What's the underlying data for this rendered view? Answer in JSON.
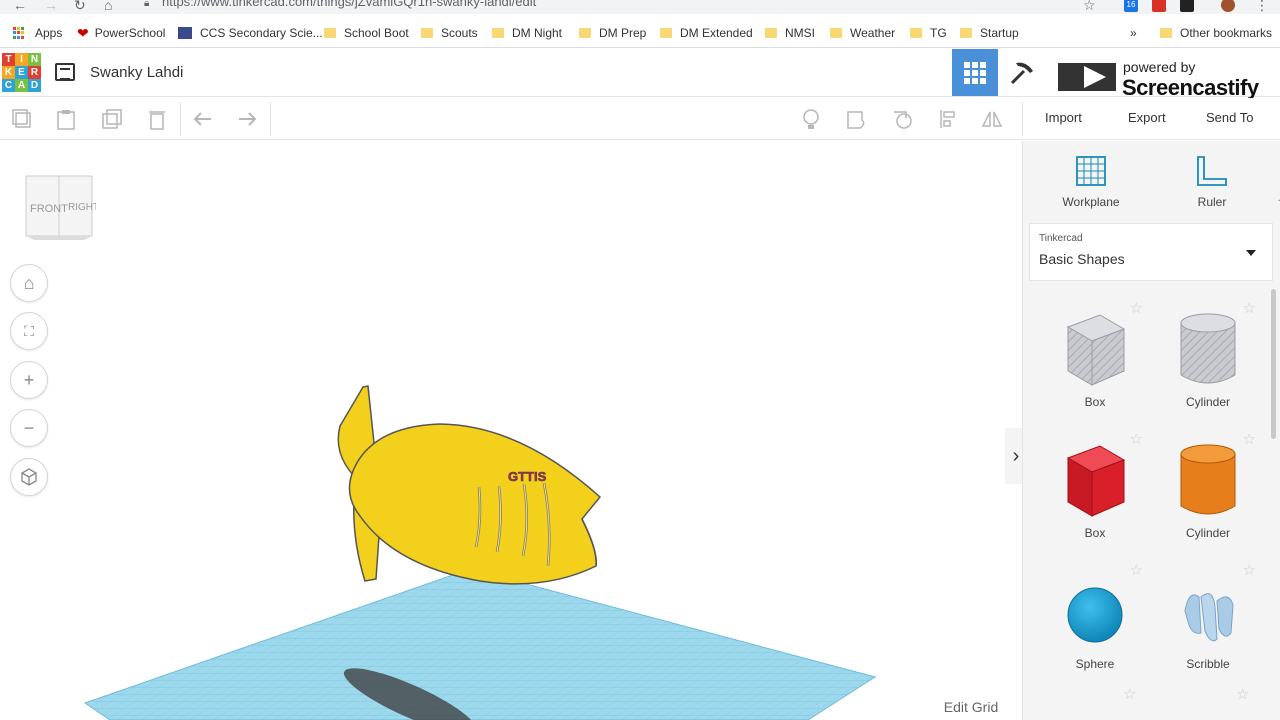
{
  "browser": {
    "url": "https://www.tinkercad.com/things/jZvamiGQr1n-swanky-lahdi/edit",
    "ext_badge": "16"
  },
  "bookmarks": [
    {
      "label": "Apps"
    },
    {
      "label": "PowerSchool"
    },
    {
      "label": "CCS Secondary Scie..."
    },
    {
      "label": "School Boot"
    },
    {
      "label": "Scouts"
    },
    {
      "label": "DM Night"
    },
    {
      "label": "DM Prep"
    },
    {
      "label": "DM Extended"
    },
    {
      "label": "NMSI"
    },
    {
      "label": "Weather"
    },
    {
      "label": "TG"
    },
    {
      "label": "Startup"
    }
  ],
  "bookmarks_more": "»",
  "other_bookmarks": "Other bookmarks",
  "app": {
    "logo_letters": [
      "T",
      "I",
      "N",
      "K",
      "E",
      "R",
      "C",
      "A",
      "D"
    ],
    "project_title": "Swanky Lahdi"
  },
  "overlay": {
    "powered_by": "powered by",
    "name": "Screencastify"
  },
  "toolbar": {
    "import_label": "Import",
    "export_label": "Export",
    "send_to_label": "Send To"
  },
  "viewcube": {
    "front": "FRONT",
    "right": "RIGHT"
  },
  "canvas": {
    "edit_grid_label": "Edit Grid",
    "model_text": "GTTIS"
  },
  "panel": {
    "workplane_label": "Workplane",
    "ruler_label": "Ruler",
    "library_sub": "Tinkercad",
    "library_value": "Basic Shapes",
    "shapes": [
      {
        "label": "Box",
        "icon": "box-hole-icon"
      },
      {
        "label": "Cylinder",
        "icon": "cylinder-hole-icon"
      },
      {
        "label": "Box",
        "icon": "box-icon"
      },
      {
        "label": "Cylinder",
        "icon": "cylinder-icon"
      },
      {
        "label": "Sphere",
        "icon": "sphere-icon"
      },
      {
        "label": "Scribble",
        "icon": "scribble-icon"
      }
    ]
  },
  "colors": {
    "accent": "#4a90d9",
    "model_yellow": "#f2d01c",
    "workplane": "#8fd3ea",
    "box_red": "#d81f2a",
    "cylinder_orange": "#e67e1c",
    "sphere_blue": "#18a4d6"
  }
}
